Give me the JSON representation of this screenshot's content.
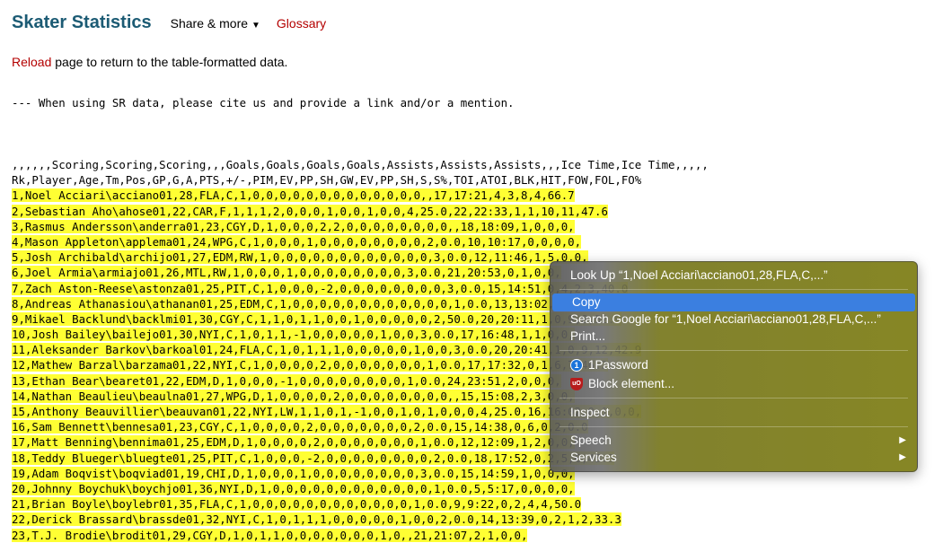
{
  "header": {
    "title": "Skater Statistics",
    "share_label": "Share & more",
    "share_caret": "▼",
    "glossary_label": "Glossary"
  },
  "reload": {
    "link": "Reload",
    "rest": " page to return to the table-formatted data."
  },
  "cite_line": "--- When using SR data, please cite us and provide a link and/or a mention.",
  "csv": {
    "header_lines": [
      ",,,,,,Scoring,Scoring,Scoring,,,Goals,Goals,Goals,Goals,Assists,Assists,Assists,,,Ice Time,Ice Time,,,,,",
      "Rk,Player,Age,Tm,Pos,GP,G,A,PTS,+/-,PIM,EV,PP,SH,GW,EV,PP,SH,S,S%,TOI,ATOI,BLK,HIT,FOW,FOL,FO%"
    ],
    "rows": [
      "1,Noel Acciari\\acciano01,28,FLA,C,1,0,0,0,0,0,0,0,0,0,0,0,0,0,,17,17:21,4,3,8,4,66.7",
      "2,Sebastian Aho\\ahose01,22,CAR,F,1,1,1,2,0,0,0,1,0,0,1,0,0,4,25.0,22,22:33,1,1,10,11,47.6",
      "3,Rasmus Andersson\\anderra01,23,CGY,D,1,0,0,0,2,2,0,0,0,0,0,0,0,0,,18,18:09,1,0,0,0,",
      "4,Mason Appleton\\applema01,24,WPG,C,1,0,0,0,1,0,0,0,0,0,0,0,0,2,0.0,10,10:17,0,0,0,0,",
      "5,Josh Archibald\\archijo01,27,EDM,RW,1,0,0,0,0,0,0,0,0,0,0,0,0,3,0.0,12,11:46,1,5,0,0,",
      "6,Joel Armia\\armiajo01,26,MTL,RW,1,0,0,0,1,0,0,0,0,0,0,0,0,3,0.0,21,20:53,0,1,0,0,",
      "7,Zach Aston-Reese\\astonza01,25,PIT,C,1,0,0,0,-2,0,0,0,0,0,0,0,0,3,0.0,15,14:51,0,4,2,3,40.0",
      "8,Andreas Athanasiou\\athanan01,25,EDM,C,1,0,0,0,0,0,0,0,0,0,0,0,0,1,0.0,13,13:02,0,0,0,1,0.0",
      "9,Mikael Backlund\\backlmi01,30,CGY,C,1,1,0,1,1,0,0,1,0,0,0,0,0,2,50.0,20,20:11,1,0,9,8,52.9",
      "10,Josh Bailey\\bailejo01,30,NYI,C,1,0,1,1,-1,0,0,0,0,0,1,0,0,3,0.0,17,16:48,1,1,0,0,",
      "11,Aleksander Barkov\\barkoal01,24,FLA,C,1,0,1,1,1,0,0,0,0,0,1,0,0,3,0.0,20,20:41,1,0,9,12,42.9",
      "12,Mathew Barzal\\barzama01,22,NYI,C,1,0,0,0,0,2,0,0,0,0,0,0,0,1,0.0,17,17:32,0,1,6,7,46.2",
      "13,Ethan Bear\\bearet01,22,EDM,D,1,0,0,0,-1,0,0,0,0,0,0,0,0,1,0.0,24,23:51,2,0,0,0,",
      "14,Nathan Beaulieu\\beaulna01,27,WPG,D,1,0,0,0,0,2,0,0,0,0,0,0,0,0,,15,15:08,2,3,0,0,",
      "15,Anthony Beauvillier\\beauvan01,22,NYI,LW,1,1,0,1,-1,0,0,1,0,1,0,0,0,4,25.0,16,16:02,0,1,0,0,",
      "16,Sam Bennett\\bennesa01,23,CGY,C,1,0,0,0,0,2,0,0,0,0,0,0,0,2,0.0,15,14:38,0,6,0,2,0.0",
      "17,Matt Benning\\bennima01,25,EDM,D,1,0,0,0,0,2,0,0,0,0,0,0,0,1,0.0,12,12:09,1,2,0,0,",
      "18,Teddy Blueger\\bluegte01,25,PIT,C,1,0,0,0,-2,0,0,0,0,0,0,0,0,2,0.0,18,17:52,0,2,5,6,45.5",
      "19,Adam Boqvist\\boqviad01,19,CHI,D,1,0,0,0,1,0,0,0,0,0,0,0,0,3,0.0,15,14:59,1,0,0,0,",
      "20,Johnny Boychuk\\boychjo01,36,NYI,D,1,0,0,0,0,0,0,0,0,0,0,0,0,1,0.0,5,5:17,0,0,0,0,",
      "21,Brian Boyle\\boylebr01,35,FLA,C,1,0,0,0,0,0,0,0,0,0,0,0,0,1,0.0,9,9:22,0,2,4,4,50.0",
      "22,Derick Brassard\\brassde01,32,NYI,C,1,0,1,1,1,0,0,0,0,0,1,0,0,2,0.0,14,13:39,0,2,1,2,33.3",
      "23,T.J. Brodie\\brodit01,29,CGY,D,1,0,1,1,0,0,0,0,0,0,0,1,0,,21,21:07,2,1,0,0,"
    ]
  },
  "context_menu": {
    "lookup": "Look Up “1,Noel Acciari\\acciano01,28,FLA,C,...”",
    "copy": "Copy",
    "search_google": "Search Google for “1,Noel Acciari\\acciano01,28,FLA,C,...”",
    "print": "Print...",
    "onepassword": "1Password",
    "block_element": "Block element...",
    "inspect": "Inspect",
    "speech": "Speech",
    "services": "Services",
    "submenu_arrow": "▶",
    "onepassword_glyph": "1",
    "ublock_glyph": "uO"
  }
}
